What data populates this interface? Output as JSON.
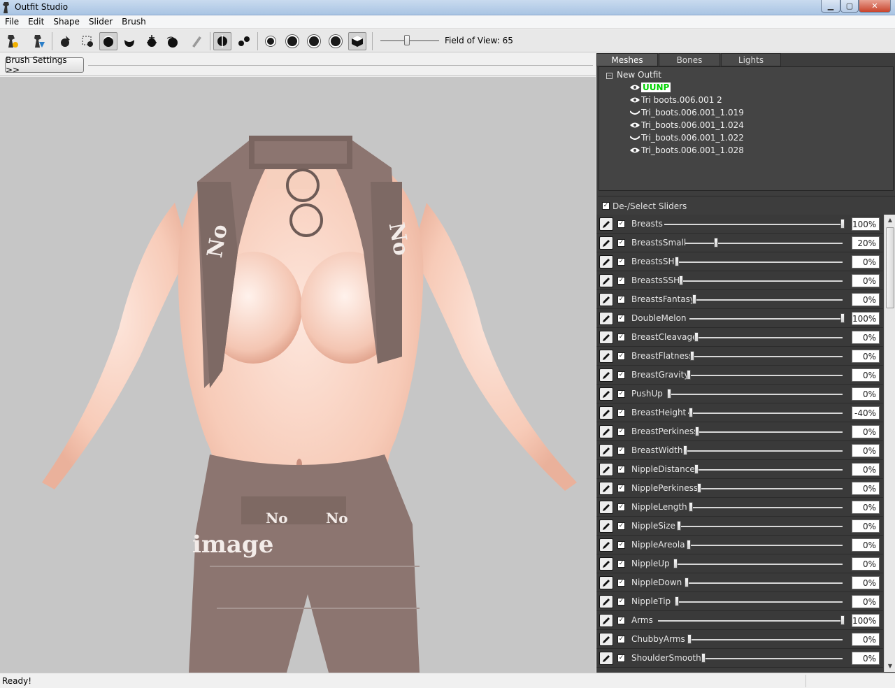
{
  "window": {
    "title": "Outfit Studio"
  },
  "menu": [
    "File",
    "Edit",
    "Shape",
    "Slider",
    "Brush"
  ],
  "toolbar": {
    "tools": [
      "load-reference-icon",
      "load-outfit-icon",
      "select-icon",
      "mask-icon",
      "inflate-icon",
      "deflate-icon",
      "move-icon",
      "smooth-icon",
      "weight-paint-icon",
      "x-mirror-icon",
      "connected-icon",
      "view-front-icon",
      "view-back-icon",
      "view-left-icon",
      "view-right-icon",
      "perspective-icon"
    ],
    "fov_label": "Field of View: 65",
    "fov_value": 65
  },
  "brush_settings_label": "Brush Settings >>",
  "tabs": [
    "Meshes",
    "Bones",
    "Lights"
  ],
  "tree": {
    "root": "New Outfit",
    "items": [
      {
        "label": "UUNP",
        "visible": "eye-open",
        "selected": true
      },
      {
        "label": "Tri boots.006.001 2",
        "visible": "eye-open",
        "selected": false
      },
      {
        "label": "Tri_boots.006.001_1.019",
        "visible": "eye-closed",
        "selected": false
      },
      {
        "label": "Tri_boots.006.001_1.024",
        "visible": "eye-open",
        "selected": false
      },
      {
        "label": "Tri_boots.006.001_1.022",
        "visible": "eye-closed",
        "selected": false
      },
      {
        "label": "Tri_boots.006.001_1.028",
        "visible": "eye-open",
        "selected": false
      }
    ]
  },
  "deselect_label": "De-/Select Sliders",
  "sliders": [
    {
      "name": "Breasts",
      "value": 100,
      "display": "100%"
    },
    {
      "name": "BreastsSmall",
      "value": 20,
      "display": "20%"
    },
    {
      "name": "BreastsSH",
      "value": 0,
      "display": "0%"
    },
    {
      "name": "BreastsSSH",
      "value": 0,
      "display": "0%"
    },
    {
      "name": "BreastsFantasy",
      "value": 0,
      "display": "0%"
    },
    {
      "name": "DoubleMelon",
      "value": 100,
      "display": "100%"
    },
    {
      "name": "BreastCleavage",
      "value": 0,
      "display": "0%"
    },
    {
      "name": "BreastFlatness",
      "value": 0,
      "display": "0%"
    },
    {
      "name": "BreastGravity",
      "value": 0,
      "display": "0%"
    },
    {
      "name": "PushUp",
      "value": 0,
      "display": "0%"
    },
    {
      "name": "BreastHeight",
      "value": -40,
      "display": "-40%"
    },
    {
      "name": "BreastPerkiness",
      "value": 0,
      "display": "0%"
    },
    {
      "name": "BreastWidth",
      "value": 0,
      "display": "0%"
    },
    {
      "name": "NippleDistance",
      "value": 0,
      "display": "0%"
    },
    {
      "name": "NipplePerkiness",
      "value": 0,
      "display": "0%"
    },
    {
      "name": "NippleLength",
      "value": 0,
      "display": "0%"
    },
    {
      "name": "NippleSize",
      "value": 0,
      "display": "0%"
    },
    {
      "name": "NippleAreola",
      "value": 0,
      "display": "0%"
    },
    {
      "name": "NippleUp",
      "value": 0,
      "display": "0%"
    },
    {
      "name": "NippleDown",
      "value": 0,
      "display": "0%"
    },
    {
      "name": "NippleTip",
      "value": 0,
      "display": "0%"
    },
    {
      "name": "Arms",
      "value": 100,
      "display": "100%"
    },
    {
      "name": "ChubbyArms",
      "value": 0,
      "display": "0%"
    },
    {
      "name": "ShoulderSmooth",
      "value": 0,
      "display": "0%"
    }
  ],
  "viewport_text": {
    "word1": "No",
    "word2": "image"
  },
  "status": "Ready!"
}
